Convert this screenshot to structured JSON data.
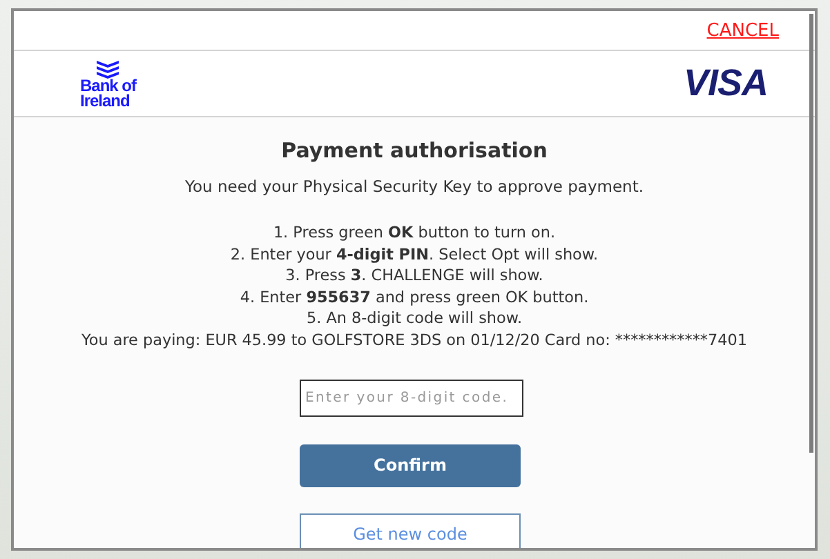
{
  "header": {
    "cancel": "CANCEL"
  },
  "logos": {
    "bank": [
      "Bank of",
      "Ireland"
    ],
    "card": "VISA"
  },
  "title": "Payment authorisation",
  "intro": "You need your Physical Security Key to approve payment.",
  "steps": [
    "1. Press green **OK** button to turn on.",
    "2. Enter your **4-digit PIN**. Select Opt will show.",
    "3. Press **3**. CHALLENGE will show.",
    "4. Enter **955637** and press green OK button.",
    "5. An 8-digit code will show."
  ],
  "payment_summary": "You are paying: EUR 45.99 to GOLFSTORE 3DS on 01/12/20 Card no: ************7401",
  "code_field": {
    "placeholder": "Enter your 8-digit code."
  },
  "buttons": {
    "confirm": "Confirm",
    "new_code": "Get new code"
  }
}
